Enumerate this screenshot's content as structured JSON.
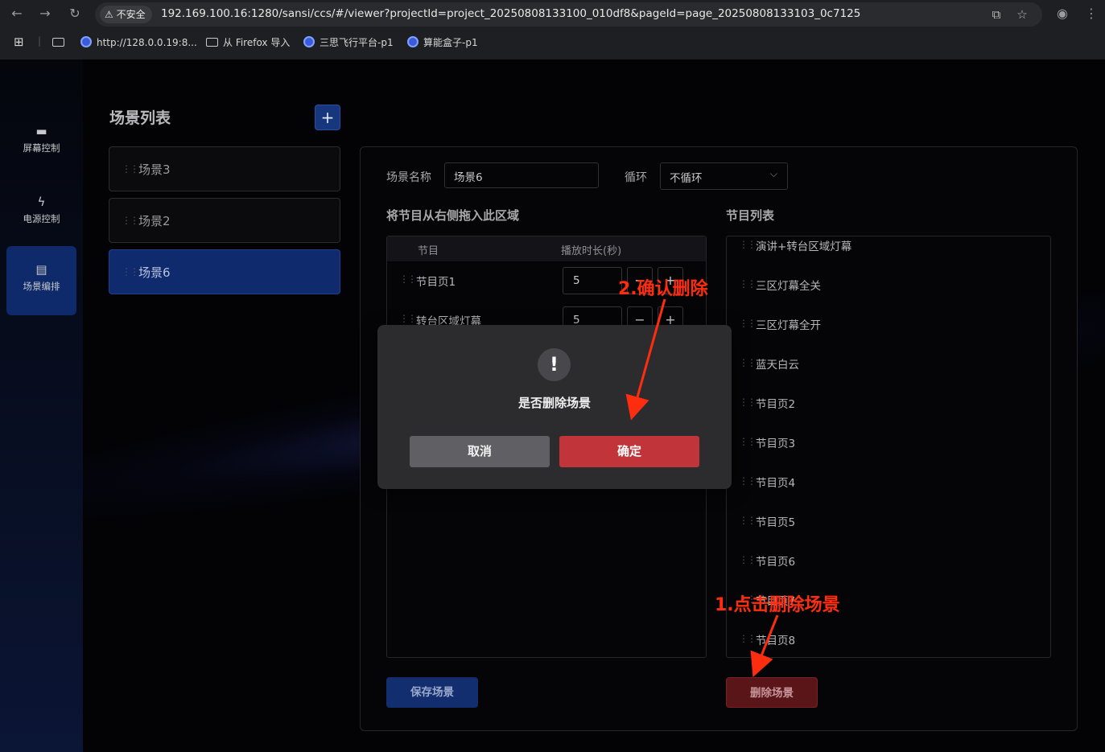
{
  "browser": {
    "security_label": "不安全",
    "url": "192.169.100.16:1280/sansi/ccs/#/viewer?projectId=project_20250808133100_010df8&pageId=page_20250808133103_0c7125",
    "bookmarks": [
      "http://128.0.0.19:8...",
      "从 Firefox 导入",
      "三思飞行平台-p1",
      "算能盒子-p1"
    ]
  },
  "sidebar": {
    "items": [
      {
        "label": "屏幕控制",
        "icon": "monitor-icon",
        "active": false
      },
      {
        "label": "电源控制",
        "icon": "lightning-icon",
        "active": false
      },
      {
        "label": "场景编排",
        "icon": "clapperboard-icon",
        "active": true
      }
    ]
  },
  "scene_list": {
    "title": "场景列表",
    "add_label": "+",
    "scenes": [
      {
        "name": "场景3",
        "active": false
      },
      {
        "name": "场景2",
        "active": false
      },
      {
        "name": "场景6",
        "active": true
      }
    ]
  },
  "editor": {
    "name_label": "场景名称",
    "name_value": "场景6",
    "loop_label": "循环",
    "loop_value": "不循环",
    "drop_title": "将节目从右侧拖入此区域",
    "col_program": "节目",
    "col_duration": "播放时长(秒)",
    "rows": [
      {
        "name": "节目页1",
        "duration": "5"
      },
      {
        "name": "转台区域灯幕",
        "duration": "5"
      }
    ],
    "minus": "−",
    "plus": "+",
    "program_list_title": "节目列表",
    "programs": [
      "演讲+转台区域灯幕",
      "三区灯幕全关",
      "三区灯幕全开",
      "蓝天白云",
      "节目页2",
      "节目页3",
      "节目页4",
      "节目页5",
      "节目页6",
      "节目页7",
      "节目页8"
    ],
    "save_label": "保存场景",
    "delete_label": "删除场景"
  },
  "modal": {
    "icon": "!",
    "message": "是否删除场景",
    "cancel_label": "取消",
    "confirm_label": "确定"
  },
  "annotations": {
    "step1": "1.点击删除场景",
    "step2": "2.确认删除",
    "color": "#ff2d10"
  }
}
